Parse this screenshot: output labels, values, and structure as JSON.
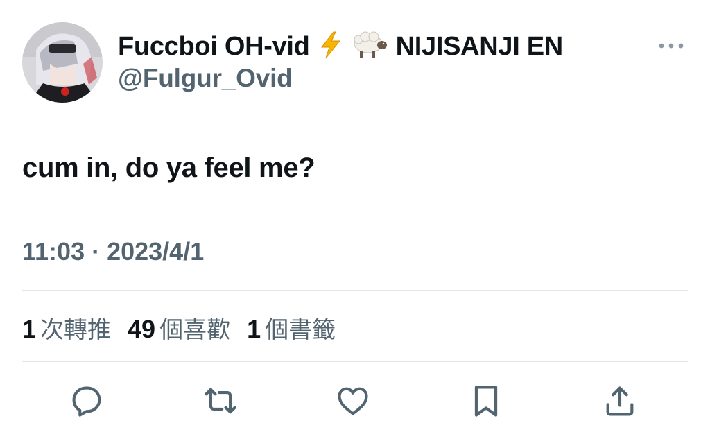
{
  "author": {
    "display_name": "Fuccboi OH-vid",
    "badges": [
      "lightning-icon",
      "sheep-icon"
    ],
    "org_name": "NIJISANJI EN",
    "handle": "@Fulgur_Ovid"
  },
  "tweet": {
    "text": "cum in, do ya feel me?",
    "time": "11:03",
    "separator": "·",
    "date": "2023/4/1"
  },
  "stats": [
    {
      "count": "1",
      "label": "次轉推"
    },
    {
      "count": "49",
      "label": "個喜歡"
    },
    {
      "count": "1",
      "label": "個書籤"
    }
  ],
  "actions": [
    "reply-icon",
    "retweet-icon",
    "like-icon",
    "bookmark-icon",
    "share-icon"
  ],
  "colors": {
    "text": "#0f1419",
    "secondary": "#536471",
    "divider": "#e1e6ea",
    "bolt": "#f7b500"
  }
}
